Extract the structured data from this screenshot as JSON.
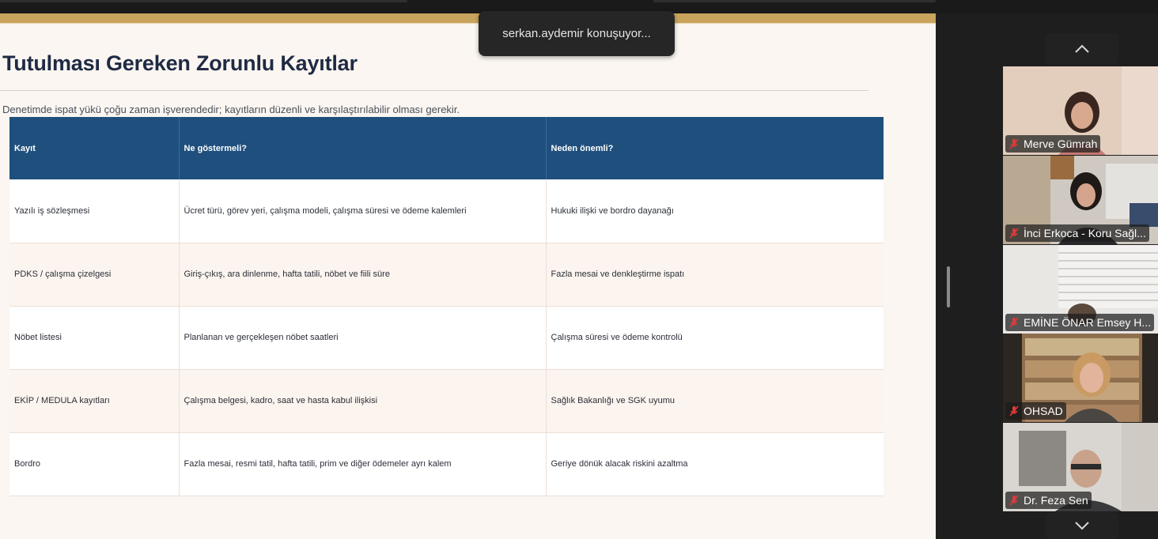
{
  "speaker_notification": "serkan.aydemir konuşuyor...",
  "slide": {
    "title": "Tutulması Gereken Zorunlu Kayıtlar",
    "subtitle": "Denetimde ispat yükü çoğu zaman işverendedir; kayıtların düzenli ve karşılaştırılabilir olması gerekir.",
    "table": {
      "headers": [
        "Kayıt",
        "Ne göstermeli?",
        "Neden önemli?"
      ],
      "rows": [
        [
          "Yazılı iş sözleşmesi",
          "Ücret türü, görev yeri, çalışma modeli, çalışma süresi ve ödeme kalemleri",
          "Hukuki ilişki ve bordro dayanağı"
        ],
        [
          "PDKS / çalışma çizelgesi",
          "Giriş-çıkış, ara dinlenme, hafta tatili, nöbet ve fiili süre",
          "Fazla mesai ve denkleştirme ispatı"
        ],
        [
          "Nöbet listesi",
          "Planlanan ve gerçekleşen nöbet saatleri",
          "Çalışma süresi ve ödeme kontrolü"
        ],
        [
          "EKİP / MEDULA kayıtları",
          "Çalışma belgesi, kadro, saat ve hasta kabul ilişkisi",
          "Sağlık Bakanlığı ve SGK uyumu"
        ],
        [
          "Bordro",
          "Fazla mesai, resmi tatil, hafta tatili, prim ve diğer ödemeler ayrı kalem",
          "Geriye dönük alacak riskini azaltma"
        ]
      ]
    },
    "colors": {
      "header_bg": "#1f4f7d",
      "accent": "#c9a45c",
      "title": "#1f2a44"
    }
  },
  "participants": [
    {
      "name": "Merve Gümrah",
      "muted": true
    },
    {
      "name": "İnci Erkoca - Koru Sağl...",
      "muted": true
    },
    {
      "name": "EMİNE ÖNAR Emsey H...",
      "muted": true
    },
    {
      "name": "OHSAD",
      "muted": true
    },
    {
      "name": "Dr. Feza Sen",
      "muted": true
    }
  ],
  "icons": {
    "scroll_up": "chevron-up-icon",
    "scroll_down": "chevron-down-icon",
    "muted": "mic-off-icon"
  }
}
